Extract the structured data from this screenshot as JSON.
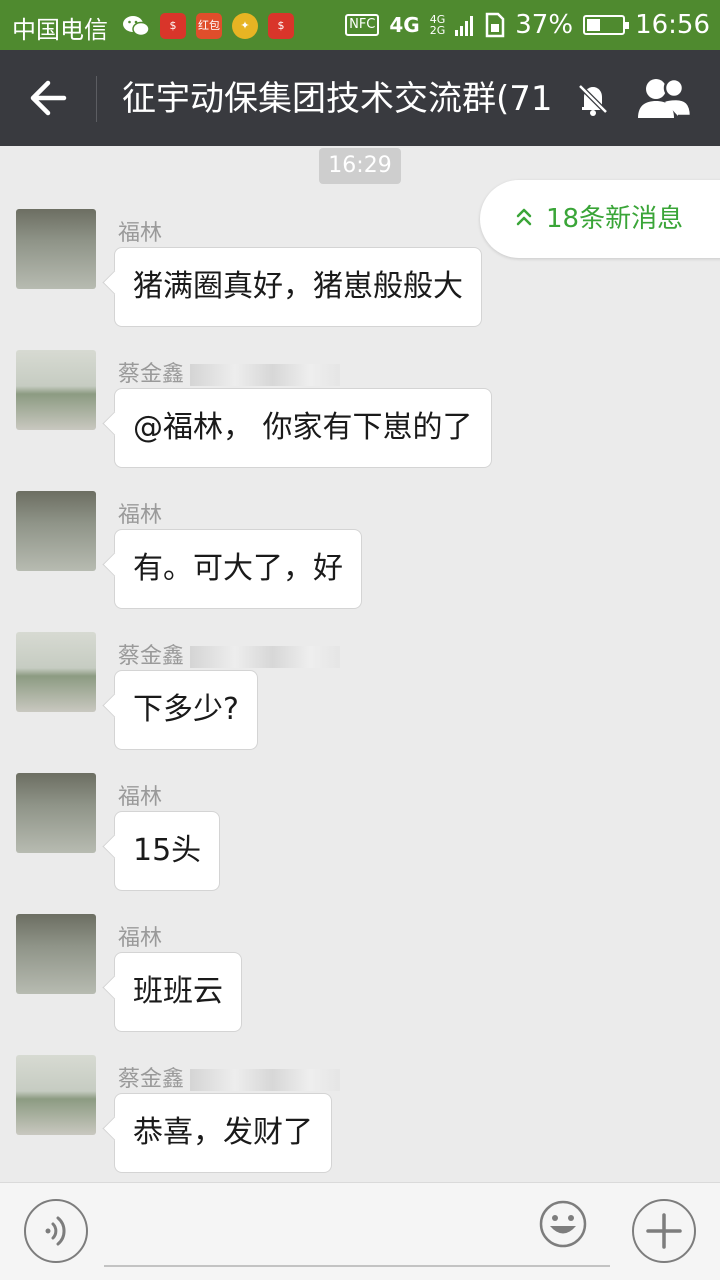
{
  "status_bar": {
    "carrier": "中国电信",
    "app_icons": [
      "wechat-icon",
      "money-locker-icon",
      "red-packet-icon",
      "game-icon",
      "money-locker-icon"
    ],
    "red_packet_label": "红包",
    "nfc": "NFC",
    "network_primary": "4G",
    "network_secondary": [
      "4G",
      "2G"
    ],
    "battery_percent": "37%",
    "battery_level": 0.37,
    "time": "16:56"
  },
  "header": {
    "back_icon": "arrow-left-icon",
    "title": "征宇动保集团技术交流群(71",
    "mute_icon": "bell-off-icon",
    "members_icon": "group-members-icon"
  },
  "timestamp": "16:29",
  "new_messages": {
    "icon": "double-chevron-up-icon",
    "label": "18条新消息",
    "color": "#3aa538"
  },
  "messages": [
    {
      "sender": "福林",
      "text": "猪满圈真好，猪崽般般大",
      "avatar": "baby"
    },
    {
      "sender": "蔡金鑫",
      "text": "@福林， 你家有下崽的了",
      "avatar": "road"
    },
    {
      "sender": "福林",
      "text": "有。可大了，好",
      "avatar": "baby"
    },
    {
      "sender": "蔡金鑫",
      "text": "下多少?",
      "avatar": "road"
    },
    {
      "sender": "福林",
      "text": "15头",
      "avatar": "baby"
    },
    {
      "sender": "福林",
      "text": "班班云",
      "avatar": "baby"
    },
    {
      "sender": "蔡金鑫",
      "text": "恭喜，发财了",
      "avatar": "road"
    }
  ],
  "input_bar": {
    "voice_icon": "voice-icon",
    "emoji_icon": "emoji-icon",
    "plus_icon": "plus-icon"
  },
  "colors": {
    "status_bar": "#4f8a2f",
    "title_bar": "#393a3f",
    "chat_bg": "#ebebeb"
  }
}
